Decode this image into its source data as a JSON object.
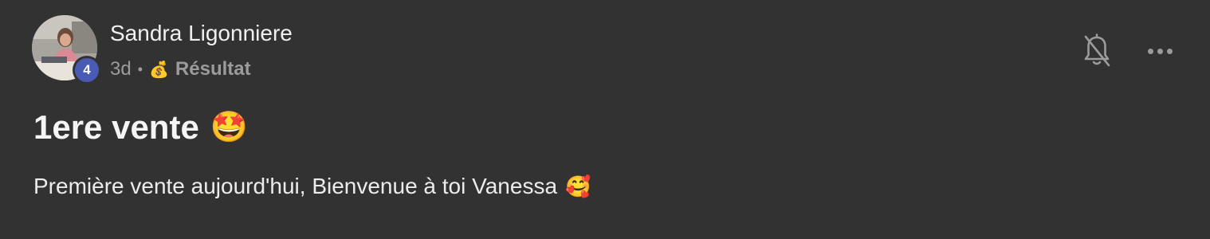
{
  "post": {
    "author": {
      "name": "Sandra Ligonniere",
      "level": "4",
      "avatar_icon": "user-photo-avatar"
    },
    "meta": {
      "age": "3d",
      "separator": "•",
      "category_emoji": "💰",
      "category": "Résultat"
    },
    "actions": {
      "notifications_icon": "bell-off-icon",
      "more_icon": "more-horizontal-icon"
    },
    "title": "1ere vente",
    "title_emoji": "🤩",
    "body": "Première vente aujourd'hui, Bienvenue à toi Vanessa",
    "body_emoji": "🥰"
  },
  "colors": {
    "background": "#323232",
    "badge": "#4a5bb3",
    "muted_text": "#9b9b9b",
    "primary_text": "#f0f0f0"
  }
}
